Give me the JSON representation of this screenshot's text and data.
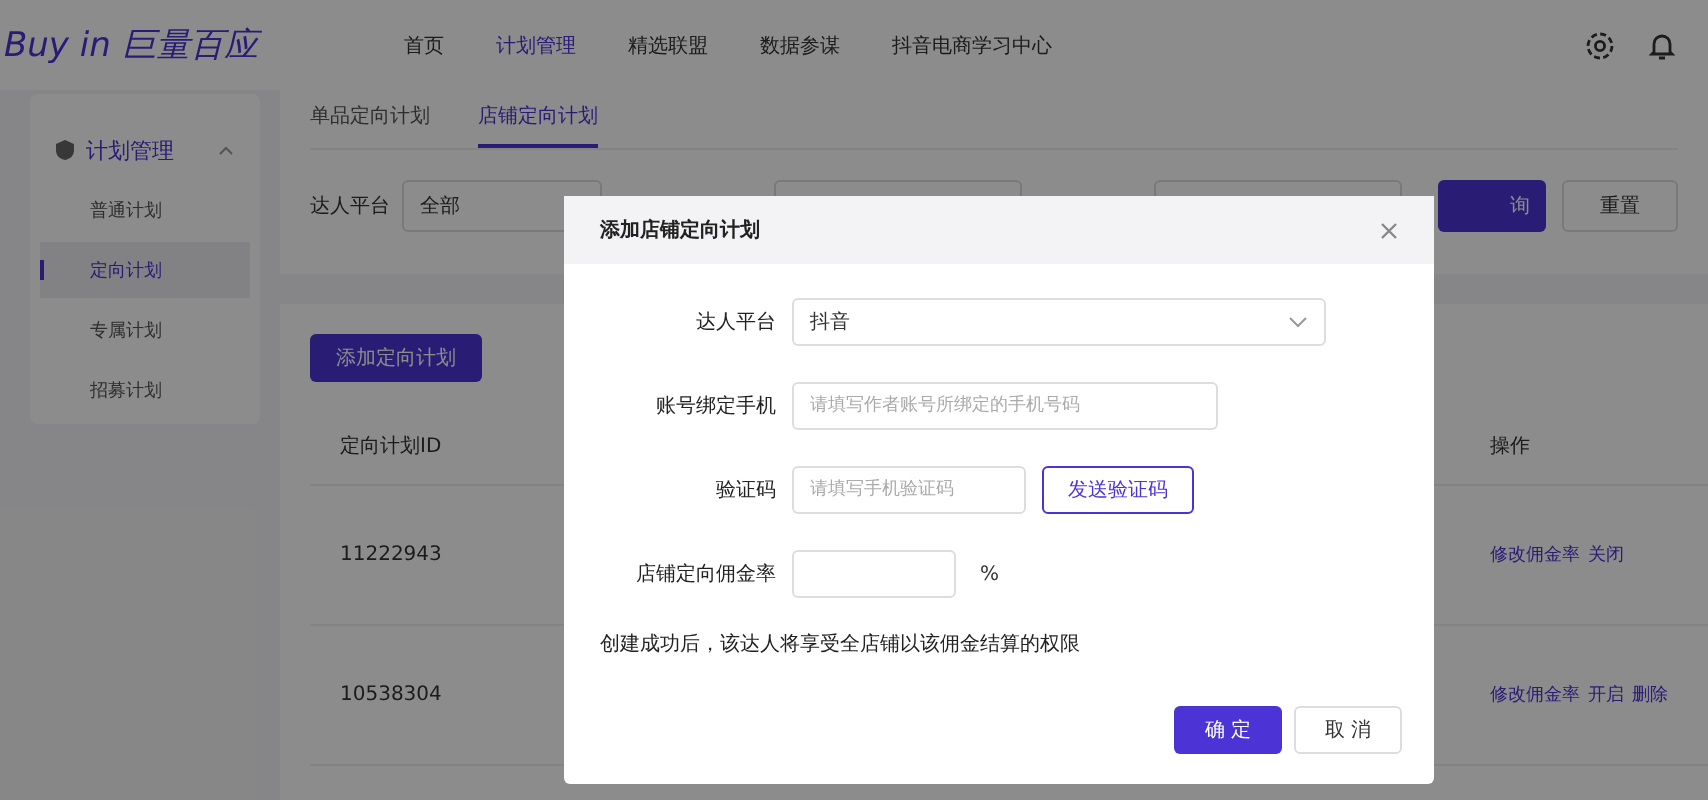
{
  "header": {
    "logo": "Buy in 巨量百应",
    "nav": [
      {
        "label": "首页",
        "selected": false
      },
      {
        "label": "计划管理",
        "selected": true
      },
      {
        "label": "精选联盟",
        "selected": false
      },
      {
        "label": "数据参谋",
        "selected": false
      },
      {
        "label": "抖音电商学习中心",
        "selected": false
      }
    ]
  },
  "sidebar": {
    "group": {
      "label": "计划管理",
      "expanded": true
    },
    "items": [
      {
        "label": "普通计划",
        "selected": false
      },
      {
        "label": "定向计划",
        "selected": true
      },
      {
        "label": "专属计划",
        "selected": false
      },
      {
        "label": "招募计划",
        "selected": false
      }
    ]
  },
  "tabs": [
    {
      "label": "单品定向计划",
      "selected": false
    },
    {
      "label": "店铺定向计划",
      "selected": true
    }
  ],
  "filter": {
    "label": "达人平台",
    "value": "全部",
    "search_button": "询",
    "reset_button": "重置"
  },
  "add_button": "添加定向计划",
  "table": {
    "columns": [
      "定向计划ID",
      "操作"
    ],
    "rows": [
      {
        "id": "11222943",
        "actions": [
          "修改佣金率",
          "关闭"
        ]
      },
      {
        "id": "10538304",
        "actions": [
          "修改佣金率",
          "开启",
          "删除"
        ]
      }
    ]
  },
  "dialog": {
    "title": "添加店铺定向计划",
    "fields": [
      {
        "kind": "select",
        "label": "达人平台",
        "value": "抖音"
      },
      {
        "kind": "input",
        "label": "账号绑定手机",
        "placeholder": "请填写作者账号所绑定的手机号码"
      },
      {
        "kind": "code",
        "label": "验证码",
        "placeholder": "请填写手机验证码",
        "button": "发送验证码"
      },
      {
        "kind": "percent",
        "label": "店铺定向佣金率",
        "suffix": "%"
      }
    ],
    "note": "创建成功后，该达人将享受全店铺以该佣金结算的权限",
    "buttons": [
      "确 定",
      "取 消"
    ]
  }
}
